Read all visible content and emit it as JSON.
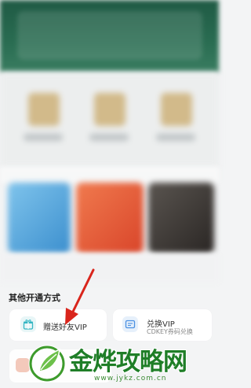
{
  "section": {
    "title": "其他开通方式"
  },
  "options": [
    {
      "label": "赠送好友VIP",
      "sub": "",
      "icon": "gift-icon",
      "icon_color": "#e8f6f7",
      "icon_fg": "#35b6c3"
    },
    {
      "label": "兑换VIP",
      "sub": "CDKEY券码兑换",
      "icon": "voucher-icon",
      "icon_color": "#e6f0fb",
      "icon_fg": "#4a90e2"
    }
  ],
  "watermark": {
    "title": "金烨攻略网",
    "url": "www.jykz.com.cn"
  },
  "colors": {
    "arrow": "#d9251c",
    "watermark_green": "#1f7e27",
    "banner": "#2a6d52"
  }
}
